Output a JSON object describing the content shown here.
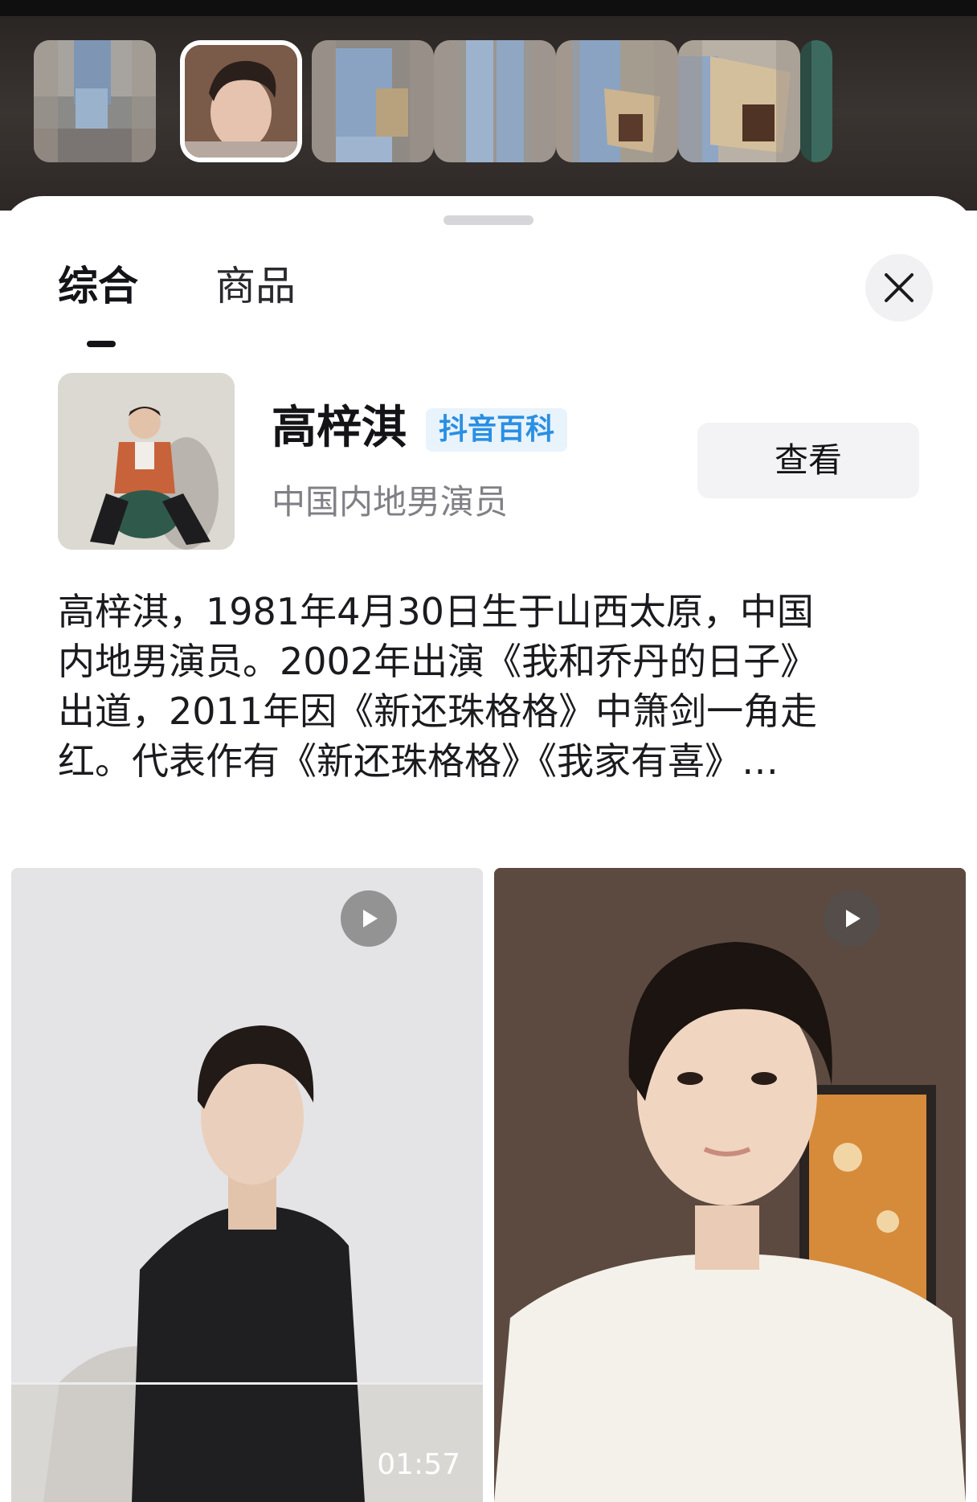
{
  "thumbnails": [
    {
      "desc": "denim-outfit-photo",
      "active": false
    },
    {
      "desc": "face-portrait-photo",
      "active": true
    },
    {
      "desc": "denim-shirt-bag-photo",
      "active": false
    },
    {
      "desc": "wide-leg-jeans-photo",
      "active": false
    },
    {
      "desc": "shoulder-bag-photo",
      "active": false
    },
    {
      "desc": "canvas-leather-bag-photo",
      "active": false
    },
    {
      "desc": "partial-thumbnail",
      "active": false
    }
  ],
  "tabs": [
    {
      "label": "综合",
      "active": true
    },
    {
      "label": "商品",
      "active": false
    }
  ],
  "profile": {
    "name": "高梓淇",
    "tag": "抖音百科",
    "subtitle": "中国内地男演员",
    "view_button": "查看"
  },
  "bio": {
    "lines": [
      "高梓淇，1981年4月30日生于山西太原，中国",
      "内地男演员。2002年出演《我和乔丹的日子》",
      "出道，2011年因《新还珠格格》中箫剑一角走",
      "红。代表作有《新还珠格格》《我家有喜》…"
    ]
  },
  "videos": [
    {
      "duration": "01:57"
    },
    {
      "duration": ""
    }
  ],
  "colors": {
    "tag_bg": "#e8f3fb",
    "tag_text": "#2a8fe3",
    "button_bg": "#f3f3f5"
  }
}
